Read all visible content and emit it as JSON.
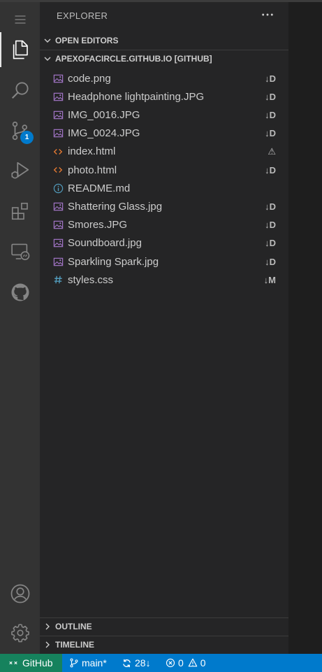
{
  "sidebar": {
    "title": "EXPLORER",
    "open_editors_label": "OPEN EDITORS",
    "repo_label": "APEXOFACIRCLE.GITHUB.IO [GITHUB]",
    "outline_label": "OUTLINE",
    "timeline_label": "TIMELINE"
  },
  "activity": {
    "scm_badge": "1"
  },
  "files": [
    {
      "name": "code.png",
      "status": "↓D",
      "icon": "image-icon"
    },
    {
      "name": "Headphone lightpainting.JPG",
      "status": "↓D",
      "icon": "image-icon"
    },
    {
      "name": "IMG_0016.JPG",
      "status": "↓D",
      "icon": "image-icon"
    },
    {
      "name": "IMG_0024.JPG",
      "status": "↓D",
      "icon": "image-icon"
    },
    {
      "name": "index.html",
      "status": "⚠",
      "icon": "html-icon"
    },
    {
      "name": "photo.html",
      "status": "↓D",
      "icon": "html-icon"
    },
    {
      "name": "README.md",
      "status": "",
      "icon": "info-icon"
    },
    {
      "name": "Shattering Glass.jpg",
      "status": "↓D",
      "icon": "image-icon"
    },
    {
      "name": "Smores.JPG",
      "status": "↓D",
      "icon": "image-icon"
    },
    {
      "name": "Soundboard.jpg",
      "status": "↓D",
      "icon": "image-icon"
    },
    {
      "name": "Sparkling Spark.jpg",
      "status": "↓D",
      "icon": "image-icon"
    },
    {
      "name": "styles.css",
      "status": "↓M",
      "icon": "hash-icon"
    }
  ],
  "status_bar": {
    "remote": "GitHub",
    "branch": "main*",
    "sync": "28↓",
    "errors": "0",
    "warnings": "0"
  },
  "colors": {
    "accent": "#007acc",
    "remote_bg": "#16825d",
    "image_icon": "#a074c4",
    "html_icon": "#e37933",
    "info_icon": "#519aba",
    "css_icon": "#519aba"
  }
}
